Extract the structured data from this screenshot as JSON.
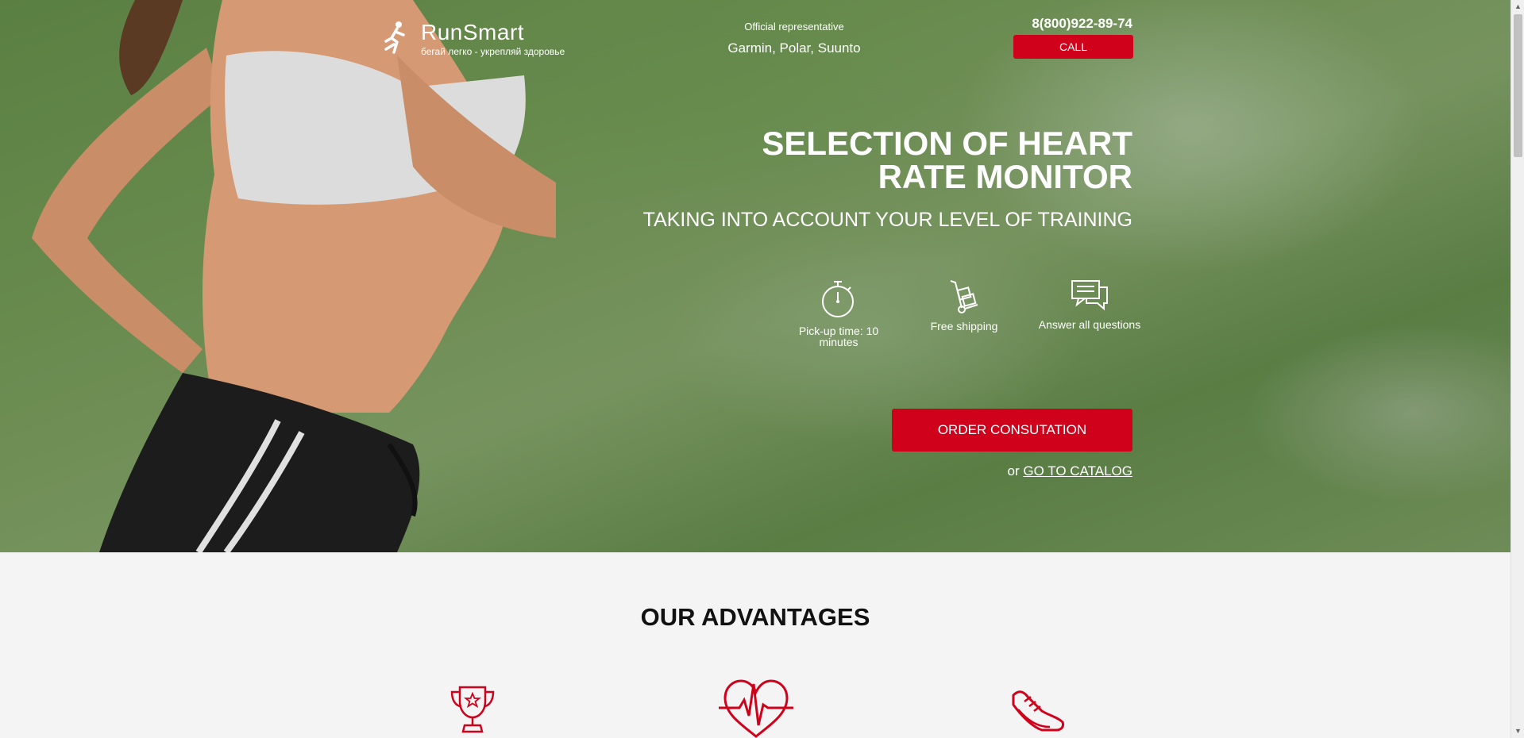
{
  "header": {
    "logo_title": "RunSmart",
    "logo_subtitle": "бегай легко - укрепляй здоровье",
    "rep_top": "Official representative",
    "rep_brands": "Garmin, Polar, Suunto",
    "phone": "8(800)922-89-74",
    "call_label": "CALL"
  },
  "hero": {
    "title": "SELECTION OF HEART RATE MONITOR",
    "subtitle": "TAKING INTO ACCOUNT YOUR LEVEL OF TRAINING",
    "features": [
      {
        "icon": "stopwatch-icon",
        "label": "Pick-up time: 10 minutes"
      },
      {
        "icon": "hand-truck-icon",
        "label": "Free shipping"
      },
      {
        "icon": "chat-bubbles-icon",
        "label": "Answer all questions"
      }
    ],
    "order_label": "ORDER CONSUTATION",
    "or_text": "or",
    "catalog_link": "GO TO CATALOG"
  },
  "advantages": {
    "title": "OUR ADVANTAGES",
    "icons": [
      "trophy-icon",
      "heartbeat-icon",
      "sneaker-icon"
    ]
  },
  "colors": {
    "accent": "#d0021b",
    "page_bg": "#f4f4f4",
    "hero_text": "#ffffff"
  }
}
